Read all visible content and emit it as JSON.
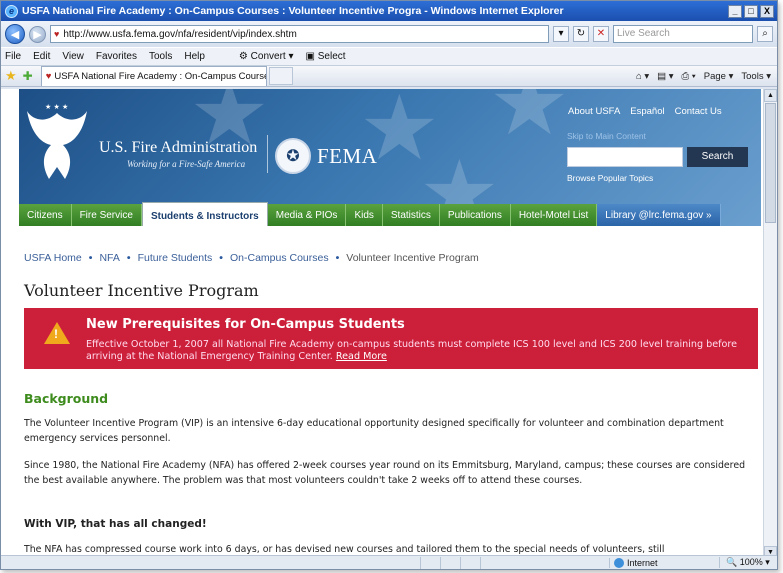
{
  "window": {
    "title": "USFA National Fire Academy : On-Campus Courses : Volunteer Incentive Progra - Windows Internet Explorer",
    "minimize": "_",
    "maximize": "□",
    "close": "X"
  },
  "address_bar": {
    "url": "http://www.usfa.fema.gov/nfa/resident/vip/index.shtm",
    "search_placeholder": "Live Search"
  },
  "menu": [
    "File",
    "Edit",
    "View",
    "Favorites",
    "Tools",
    "Help"
  ],
  "toolbar_extras": {
    "convert": "Convert",
    "select": "Select"
  },
  "tab": {
    "title": "USFA National Fire Academy : On-Campus Courses : ..."
  },
  "command_bar": {
    "page": "Page",
    "tools": "Tools"
  },
  "header": {
    "org_title": "U.S. Fire Administration",
    "org_subtitle": "Working for a Fire-Safe America",
    "fema": "FEMA",
    "links": [
      "About USFA",
      "Español",
      "Contact Us"
    ],
    "skip": "Skip to Main Content",
    "search_button": "Search",
    "popular": "Browse Popular Topics"
  },
  "nav": [
    "Citizens",
    "Fire Service",
    "Students & Instructors",
    "Media & PIOs",
    "Kids",
    "Statistics",
    "Publications",
    "Hotel-Motel List",
    "Library @lrc.fema.gov »"
  ],
  "breadcrumb": [
    "USFA Home",
    "NFA",
    "Future Students",
    "On-Campus Courses",
    "Volunteer Incentive Program"
  ],
  "page_title": "Volunteer Incentive Program",
  "alert": {
    "title": "New Prerequisites for On-Campus Students",
    "body": "Effective October 1, 2007 all National Fire Academy on-campus students must complete ICS 100 level and ICS 200 level training before arriving at the National Emergency Training Center.",
    "link": "Read More"
  },
  "content": {
    "section_heading": "Background",
    "p1": "The Volunteer Incentive Program (VIP) is an intensive 6-day educational opportunity designed specifically for volunteer and combination department emergency services personnel.",
    "p2": "Since 1980, the National Fire Academy (NFA) has offered 2-week courses year round on its Emmitsburg, Maryland, campus; these courses are considered the best available anywhere. The problem was that most volunteers couldn't take 2 weeks off to attend these courses.",
    "subheading": "With VIP, that has all changed!",
    "p3": "The NFA has compressed course work into 6 days, or has devised new courses and tailored them to the special needs of volunteers, still"
  },
  "status": {
    "zone": "Internet",
    "zoom": "100%"
  }
}
